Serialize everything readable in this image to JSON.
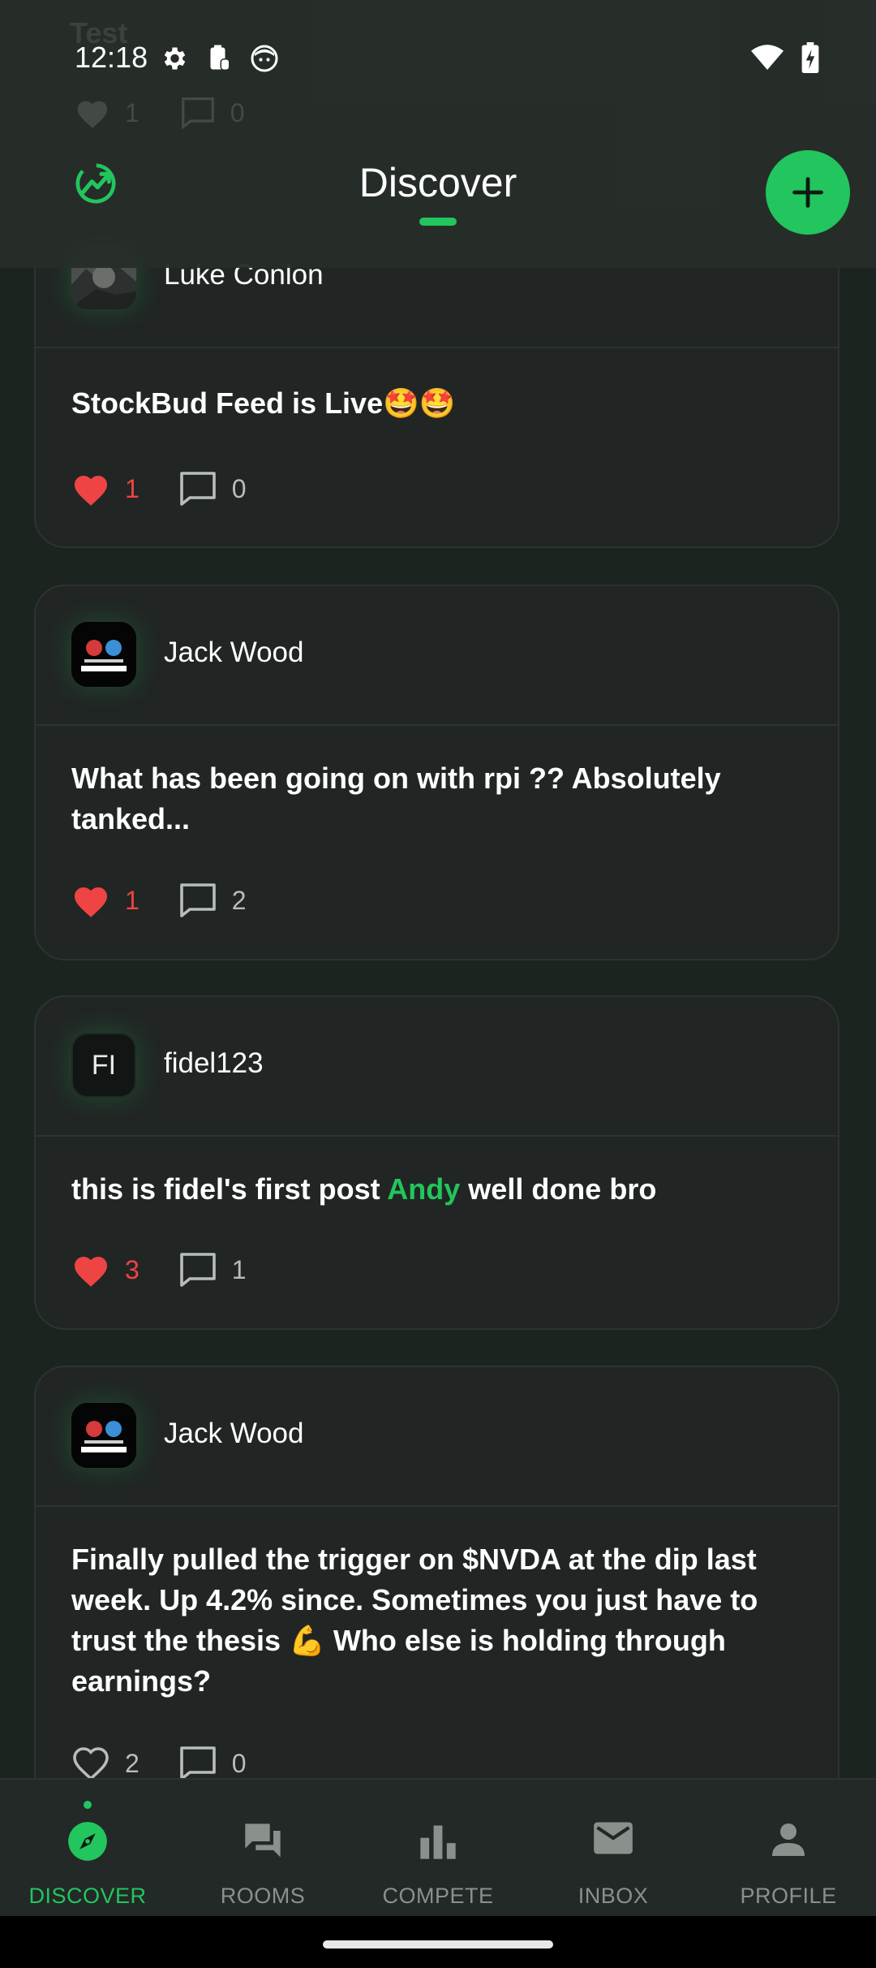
{
  "status_bar": {
    "time": "12:18"
  },
  "header": {
    "title": "Discover",
    "ghost_post_title": "Test",
    "ghost_likes": "1",
    "ghost_comments": "0"
  },
  "posts": [
    {
      "author": "Luke Conlon",
      "text": "StockBud Feed is Live🤩🤩",
      "likes": "1",
      "comments": "0",
      "liked": true
    },
    {
      "author": "Jack Wood",
      "text": "What has been going on with rpi ?? Absolutely tanked...",
      "likes": "1",
      "comments": "2",
      "liked": true
    },
    {
      "author": "fidel123",
      "avatar_initials": "FI",
      "text_before": "this is fidel's first post ",
      "mention": "Andy",
      "text_after": " well done bro",
      "likes": "3",
      "comments": "1",
      "liked": true
    },
    {
      "author": "Jack Wood",
      "text": "Finally pulled the trigger on $NVDA at the dip last week. Up 4.2% since. Sometimes you just have to trust the thesis 💪 Who else is holding through earnings?",
      "likes": "2",
      "comments": "0",
      "liked": false
    }
  ],
  "bottom_nav": [
    {
      "label": "DISCOVER",
      "icon": "compass-icon",
      "active": true
    },
    {
      "label": "ROOMS",
      "icon": "chat-bubbles-icon",
      "active": false
    },
    {
      "label": "COMPETE",
      "icon": "bar-chart-icon",
      "active": false
    },
    {
      "label": "INBOX",
      "icon": "mail-icon",
      "active": false
    },
    {
      "label": "PROFILE",
      "icon": "person-icon",
      "active": false
    }
  ],
  "colors": {
    "accent": "#22c55e",
    "like": "#ef4444",
    "background": "#1c241f",
    "card": "#212624"
  }
}
